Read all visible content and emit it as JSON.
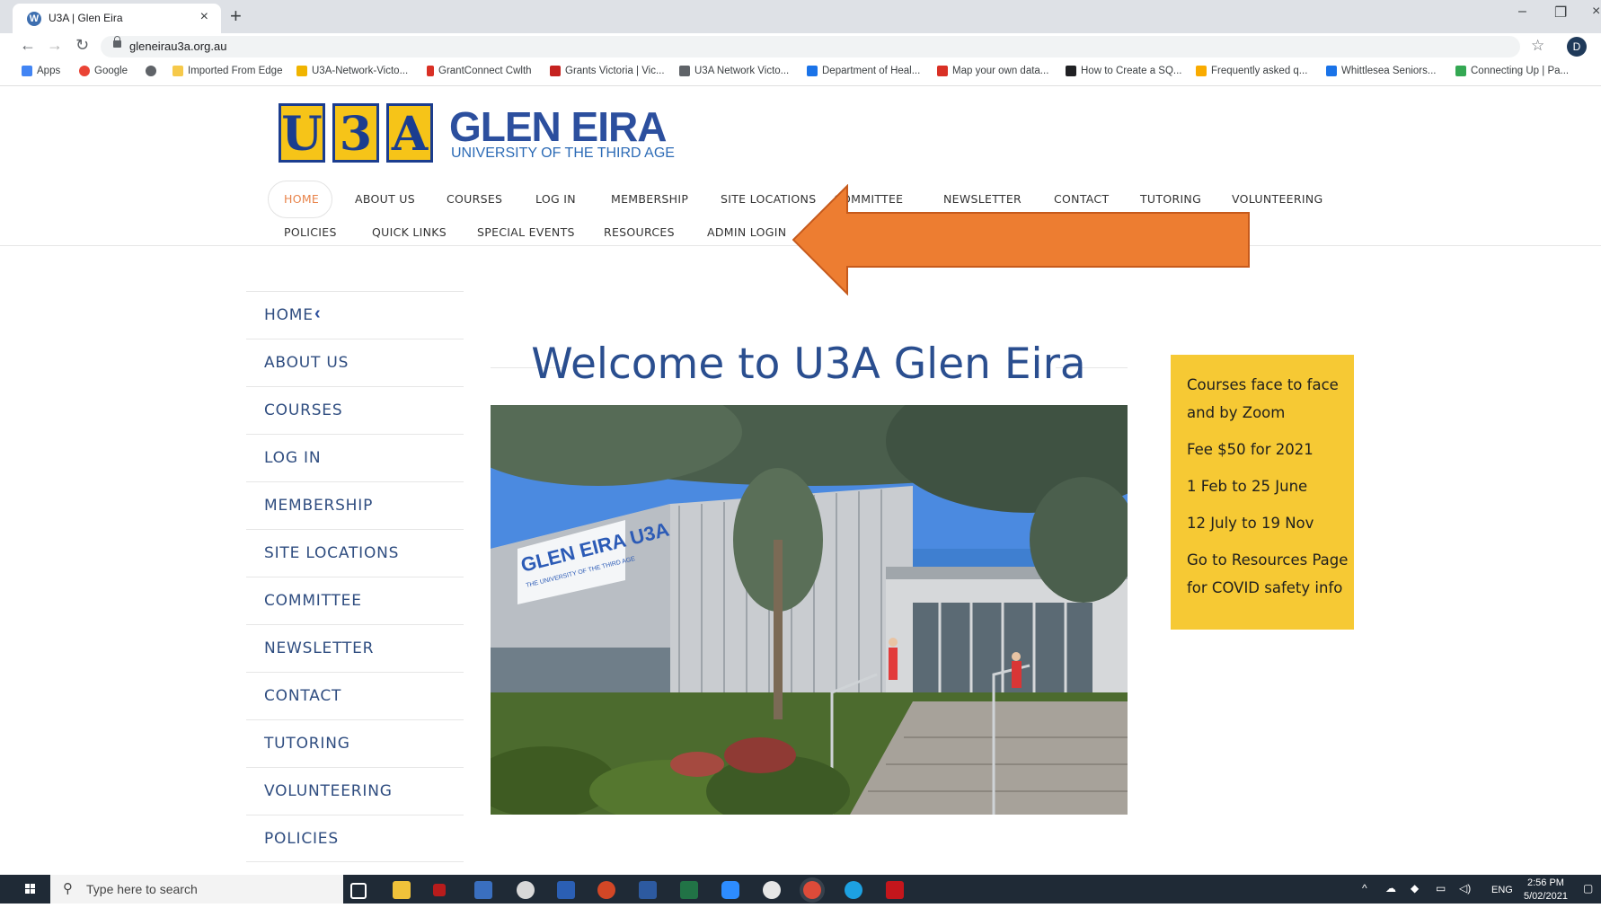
{
  "browser": {
    "tab_title": "U3A | Glen Eira",
    "tab_close": "×",
    "new_tab": "+",
    "url": "gleneirau3a.org.au",
    "profile_initial": "D",
    "bookmarks": [
      {
        "label": "Apps",
        "color": "#4285f4"
      },
      {
        "label": "Google",
        "color": "#ea4335"
      },
      {
        "label": "",
        "color": "#5f6368"
      },
      {
        "label": "Imported From Edge",
        "color": "#f6c94a"
      },
      {
        "label": "U3A-Network-Victo...",
        "color": "#f0b400"
      },
      {
        "label": "GrantConnect Cwlth",
        "color": "#d93025"
      },
      {
        "label": "Grants Victoria | Vic...",
        "color": "#c5221f"
      },
      {
        "label": "U3A Network Victo...",
        "color": "#5f6368"
      },
      {
        "label": "Department of Heal...",
        "color": "#1a73e8"
      },
      {
        "label": "Map your own data...",
        "color": "#d93025"
      },
      {
        "label": "How to Create a SQ...",
        "color": "#202124"
      },
      {
        "label": "Frequently asked q...",
        "color": "#f9ab00"
      },
      {
        "label": "Whittlesea Seniors...",
        "color": "#1a73e8"
      },
      {
        "label": "Connecting Up | Pa...",
        "color": "#34a853"
      }
    ]
  },
  "site": {
    "logo_letters": [
      "U",
      "3",
      "A"
    ],
    "logo_title": "GLEN EIRA",
    "logo_subtitle": "UNIVERSITY OF THE THIRD AGE",
    "top_nav_row1": [
      "HOME",
      "ABOUT US",
      "COURSES",
      "LOG IN",
      "MEMBERSHIP",
      "SITE LOCATIONS",
      "COMMITTEE",
      "NEWSLETTER",
      "CONTACT",
      "TUTORING",
      "VOLUNTEERING"
    ],
    "top_nav_row2": [
      "POLICIES",
      "QUICK LINKS",
      "SPECIAL EVENTS",
      "RESOURCES",
      "ADMIN LOGIN"
    ],
    "side_menu": [
      "HOME",
      "ABOUT US",
      "COURSES",
      "LOG IN",
      "MEMBERSHIP",
      "SITE LOCATIONS",
      "COMMITTEE",
      "NEWSLETTER",
      "CONTACT",
      "TUTORING",
      "VOLUNTEERING",
      "POLICIES"
    ],
    "welcome_heading": "Welcome to U3A Glen Eira",
    "photo_sign_title": "GLEN EIRA U3A",
    "photo_sign_subtitle": "THE UNIVERSITY OF THE THIRD AGE",
    "notice_lines": [
      "Courses face to face",
      "and by Zoom",
      "Fee $50 for 2021",
      "1 Feb to 25 June",
      "12 July to 19 Nov",
      "Go to Resources Page",
      "for COVID safety info"
    ],
    "colors": {
      "brand_blue": "#2c4f9e",
      "logo_yellow": "#f6c418",
      "active_nav": "#e8834a",
      "notice_bg": "#f6c934",
      "arrow": "#ed7d31"
    }
  },
  "taskbar": {
    "search_placeholder": "Type here to search",
    "language": "ENG",
    "time": "2:56 PM",
    "date": "5/02/2021"
  }
}
